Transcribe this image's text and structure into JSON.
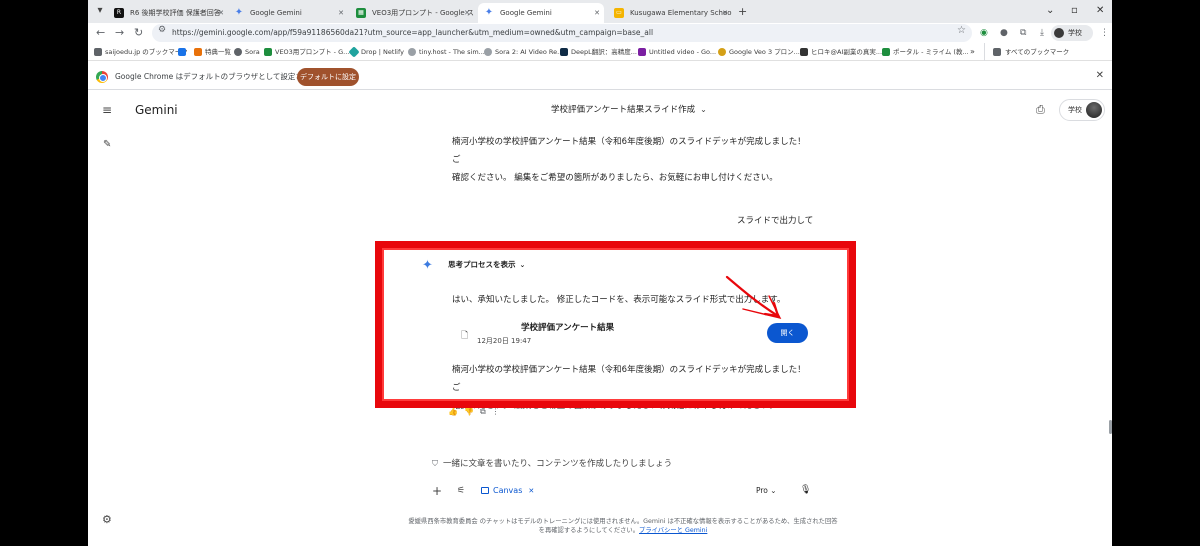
{
  "browser": {
    "tabs": [
      {
        "label": "R6 後期学校評価 保護者回答",
        "fav_color": "#111111",
        "fav_glyph": "R"
      },
      {
        "label": "Google Gemini",
        "fav_color": "#4a7fe8",
        "fav_glyph": "✦"
      },
      {
        "label": "VEO3用プロンプト - Google スプレ",
        "fav_color": "#1e8e3e",
        "fav_glyph": "▦"
      },
      {
        "label": "Google Gemini",
        "fav_color": "#4a7fe8",
        "fav_glyph": "✦"
      },
      {
        "label": "Kusugawa Elementary School E",
        "fav_color": "#f4b400",
        "fav_glyph": "▭"
      }
    ],
    "url": "https://gemini.google.com/app/f59a91186560da21?utm_source=app_launcher&utm_medium=owned&utm_campaign=base_all",
    "profile_label": "学校",
    "bookmarks": [
      {
        "label": "saijoedu.jp のブックマーク",
        "color": "#5f6368"
      },
      {
        "label": "",
        "color": "#1a73e8"
      },
      {
        "label": "特典一覧",
        "color": "#e8710a"
      },
      {
        "label": "Sora",
        "color": "#5f6368"
      },
      {
        "label": "VEO3用プロンプト - G...",
        "color": "#1e8e3e"
      },
      {
        "label": "Drop | Netlify",
        "color": "#20a39e"
      },
      {
        "label": "tiny.host - The sim...",
        "color": "#9aa0a6"
      },
      {
        "label": "Sora 2: AI Video Re...",
        "color": "#9aa0a6"
      },
      {
        "label": "DeepL翻訳：高精度...",
        "color": "#0f2b46"
      },
      {
        "label": "Untitled video - Go...",
        "color": "#7b1fa2"
      },
      {
        "label": "Google Veo 3 プロン...",
        "color": "#d4a017"
      },
      {
        "label": "ヒロキ@AI副業の真実...",
        "color": "#333333"
      },
      {
        "label": "ポータル - ミライム (教...",
        "color": "#1e8e3e"
      }
    ],
    "all_bookmarks": "すべてのブックマーク",
    "infobar_text": "Google Chrome はデフォルトのブラウザとして設定されていません",
    "infobar_button": "デフォルトに設定"
  },
  "gemini": {
    "brand": "Gemini",
    "title": "学校評価アンケート結果スライド作成",
    "profile_label": "学校",
    "messages": {
      "prev_response_1": "楠河小学校の学校評価アンケート結果（令和6年度後期）のスライドデッキが完成しました！ご",
      "prev_response_2": "確認ください。 編集をご希望の箇所がありましたら、お気軽にお申し付けください。",
      "user_message": "スライドで出力して",
      "thinking_label": "思考プロセスを表示",
      "reply_intro": "はい、承知いたしました。 修正したコードを、表示可能なスライド形式で出力します。",
      "doc_title": "学校評価アンケート結果",
      "doc_time": "12月20日 19:47",
      "open_button": "開く",
      "reply_outro_1": "楠河小学校の学校評価アンケート結果（令和6年度後期）のスライドデッキが完成しました！ご",
      "reply_outro_2": "確認ください。 編集をご希望の箇所がありましたら、お気軽にお申し付けください。"
    },
    "composer": {
      "placeholder": "一緒に文章を書いたり、コンテンツを作成したりしましょう",
      "canvas_chip": "Canvas",
      "model": "Pro"
    },
    "disclaimer_line1": "愛媛県西条市教育委員会 のチャットはモデルのトレーニングには使用されません。Gemini は不正確な情報を表示することがあるため、生成された回答",
    "disclaimer_line2": "を再確認するようにしてください。",
    "privacy_link": "プライバシーと Gemini"
  },
  "annotation": {
    "color": "#e8070c"
  }
}
